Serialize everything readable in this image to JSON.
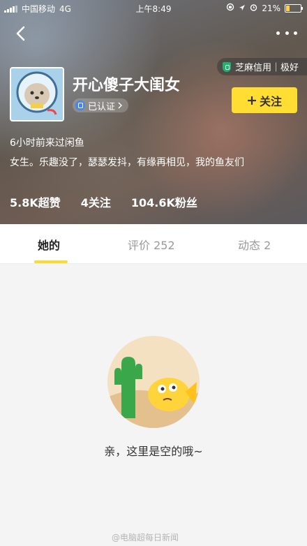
{
  "status_bar": {
    "carrier": "中国移动",
    "network": "4G",
    "time": "上午8:49",
    "battery": "21%"
  },
  "profile": {
    "name": "开心傻子大闺女",
    "verified_label": "已认证",
    "credit_label": "芝麻信用｜极好",
    "follow_label": "关注",
    "last_seen": "6小时前来过闲鱼",
    "bio": "女生。乐趣没了，瑟瑟发抖，有缘再相见，我的鱼友们",
    "stats": {
      "likes": "5.8K超赞",
      "following": "4关注",
      "followers": "104.6K粉丝"
    }
  },
  "tabs": {
    "hers": "她的",
    "reviews": "评价 252",
    "moments": "动态 2"
  },
  "empty_state": {
    "message": "亲，这里是空的哦~"
  },
  "watermark": "@电脑超每日新闻",
  "colors": {
    "accent": "#ffdd33",
    "credit_green": "#1fb36b",
    "verified_blue": "#4a86e8"
  }
}
